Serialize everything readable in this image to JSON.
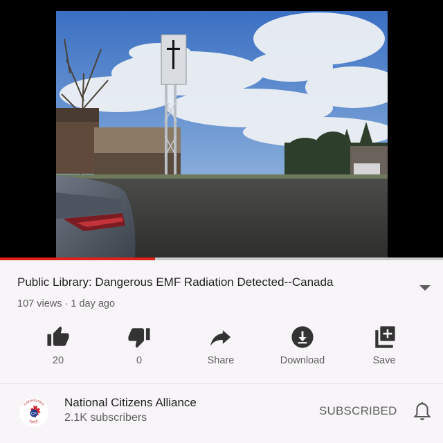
{
  "video": {
    "progress": 0.35
  },
  "info": {
    "title": "Public Library: Dangerous EMF Radiation Detected--Canada",
    "meta": "107 views · 1 day ago"
  },
  "actions": {
    "like": {
      "label": "20",
      "icon": "thumbs-up-icon"
    },
    "dislike": {
      "label": "0",
      "icon": "thumbs-down-icon"
    },
    "share": {
      "label": "Share",
      "icon": "share-icon"
    },
    "download": {
      "label": "Download",
      "icon": "download-icon"
    },
    "save": {
      "label": "Save",
      "icon": "playlist-add-icon"
    }
  },
  "channel": {
    "name": "National Citizens Alliance",
    "subscribers": "2.1K subscribers",
    "subscribe_label": "SUBSCRIBED",
    "logo_text_top": "CANADIANS",
    "logo_text_bottom": "FIRST"
  },
  "colors": {
    "progress_played": "#e0201a",
    "icon": "#333333",
    "muted_text": "#606060"
  }
}
